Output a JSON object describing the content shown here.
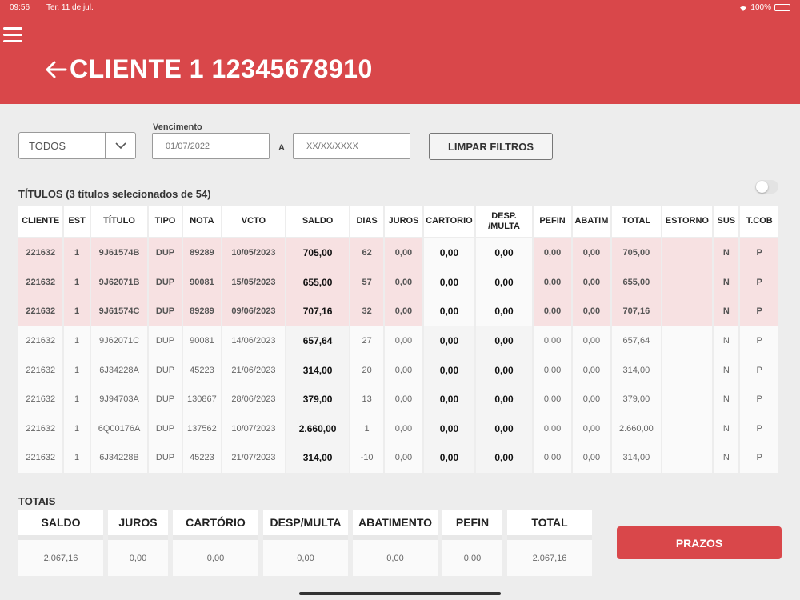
{
  "status": {
    "time": "09:56",
    "date": "Ter. 11 de jul.",
    "battery": "100%"
  },
  "header": {
    "title": "CLIENTE 1 12345678910"
  },
  "filters": {
    "select_value": "TODOS",
    "vencimento_label": "Vencimento",
    "date_from": "01/07/2022",
    "date_to_placeholder": "XX/XX/XXXX",
    "a_label": "A",
    "clear_label": "LIMPAR FILTROS"
  },
  "titulos_label": "TÍTULOS (3 títulos selecionados de 54)",
  "table": {
    "headers": [
      "CLIENTE",
      "EST",
      "TÍTULO",
      "TIPO",
      "NOTA",
      "VCTO",
      "SALDO",
      "DIAS",
      "JUROS",
      "CARTORIO",
      "DESP. /MULTA",
      "PEFIN",
      "ABATIM",
      "TOTAL",
      "ESTORNO",
      "SUS",
      "T.COB"
    ],
    "rows": [
      [
        "221632",
        "1",
        "9J61574B",
        "DUP",
        "89289",
        "10/05/2023",
        "705,00",
        "62",
        "0,00",
        "0,00",
        "0,00",
        "0,00",
        "0,00",
        "705,00",
        "",
        "N",
        "P"
      ],
      [
        "221632",
        "1",
        "9J62071B",
        "DUP",
        "90081",
        "15/05/2023",
        "655,00",
        "57",
        "0,00",
        "0,00",
        "0,00",
        "0,00",
        "0,00",
        "655,00",
        "",
        "N",
        "P"
      ],
      [
        "221632",
        "1",
        "9J61574C",
        "DUP",
        "89289",
        "09/06/2023",
        "707,16",
        "32",
        "0,00",
        "0,00",
        "0,00",
        "0,00",
        "0,00",
        "707,16",
        "",
        "N",
        "P"
      ],
      [
        "221632",
        "1",
        "9J62071C",
        "DUP",
        "90081",
        "14/06/2023",
        "657,64",
        "27",
        "0,00",
        "0,00",
        "0,00",
        "0,00",
        "0,00",
        "657,64",
        "",
        "N",
        "P"
      ],
      [
        "221632",
        "1",
        "6J34228A",
        "DUP",
        "45223",
        "21/06/2023",
        "314,00",
        "20",
        "0,00",
        "0,00",
        "0,00",
        "0,00",
        "0,00",
        "314,00",
        "",
        "N",
        "P"
      ],
      [
        "221632",
        "1",
        "9J94703A",
        "DUP",
        "130867",
        "28/06/2023",
        "379,00",
        "13",
        "0,00",
        "0,00",
        "0,00",
        "0,00",
        "0,00",
        "379,00",
        "",
        "N",
        "P"
      ],
      [
        "221632",
        "1",
        "6Q00176A",
        "DUP",
        "137562",
        "10/07/2023",
        "2.660,00",
        "1",
        "0,00",
        "0,00",
        "0,00",
        "0,00",
        "0,00",
        "2.660,00",
        "",
        "N",
        "P"
      ],
      [
        "221632",
        "1",
        "6J34228B",
        "DUP",
        "45223",
        "21/07/2023",
        "314,00",
        "-10",
        "0,00",
        "0,00",
        "0,00",
        "0,00",
        "0,00",
        "314,00",
        "",
        "N",
        "P"
      ]
    ],
    "selected_count": 3
  },
  "totais": {
    "label": "TOTAIS",
    "headers": [
      "SALDO",
      "JUROS",
      "CARTÓRIO",
      "DESP/MULTA",
      "ABATIMENTO",
      "PEFIN",
      "TOTAL"
    ],
    "values": [
      "2.067,16",
      "0,00",
      "0,00",
      "0,00",
      "0,00",
      "0,00",
      "2.067,16"
    ]
  },
  "prazos_label": "PRAZOS",
  "colors": {
    "accent": "#d9474a",
    "selected_row": "#f7e1e2",
    "background": "#ededed"
  }
}
